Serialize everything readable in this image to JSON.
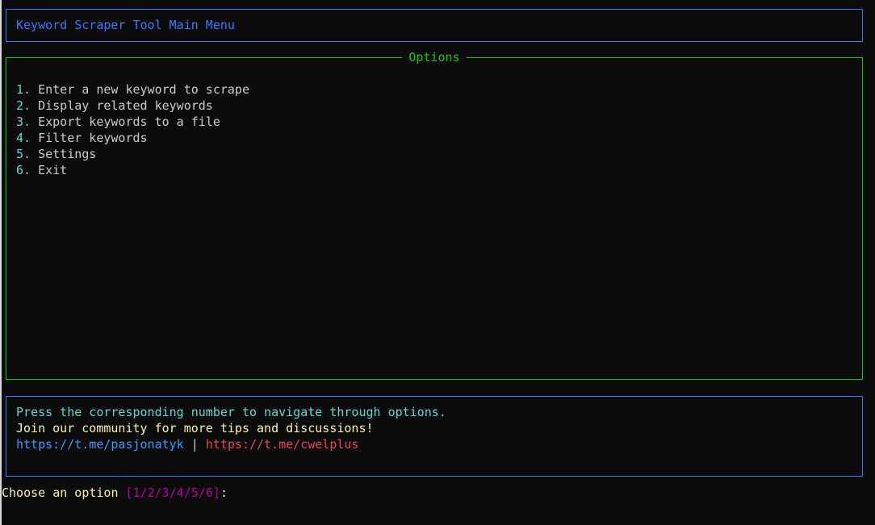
{
  "header": {
    "title": "Keyword Scraper Tool Main Menu"
  },
  "options": {
    "title": "Options",
    "items": [
      {
        "number": "1.",
        "label": "Enter a new keyword to scrape"
      },
      {
        "number": "2.",
        "label": "Display related keywords"
      },
      {
        "number": "3.",
        "label": "Export keywords to a file"
      },
      {
        "number": "4.",
        "label": "Filter keywords"
      },
      {
        "number": "5.",
        "label": "Settings"
      },
      {
        "number": "6.",
        "label": "Exit"
      }
    ]
  },
  "info": {
    "instruction": "Press the corresponding number to navigate through options.",
    "community": "Join our community for more tips and discussions!",
    "link1": "https://t.me/pasjonatyk",
    "separator": "|",
    "link2": "https://t.me/cwelplus"
  },
  "prompt": {
    "label": "Choose an option ",
    "choices": "[1/2/3/4/5/6]",
    "colon": ":",
    "value": ""
  },
  "colors": {
    "background": "#0c0c0c",
    "title_blue": "#3b78ff",
    "options_green": "#16c60c",
    "cyan": "#61d6d6",
    "yellow": "#f9f1a5",
    "link_blue": "#3b9aff",
    "link_red": "#e74856",
    "magenta": "#b4009e"
  }
}
